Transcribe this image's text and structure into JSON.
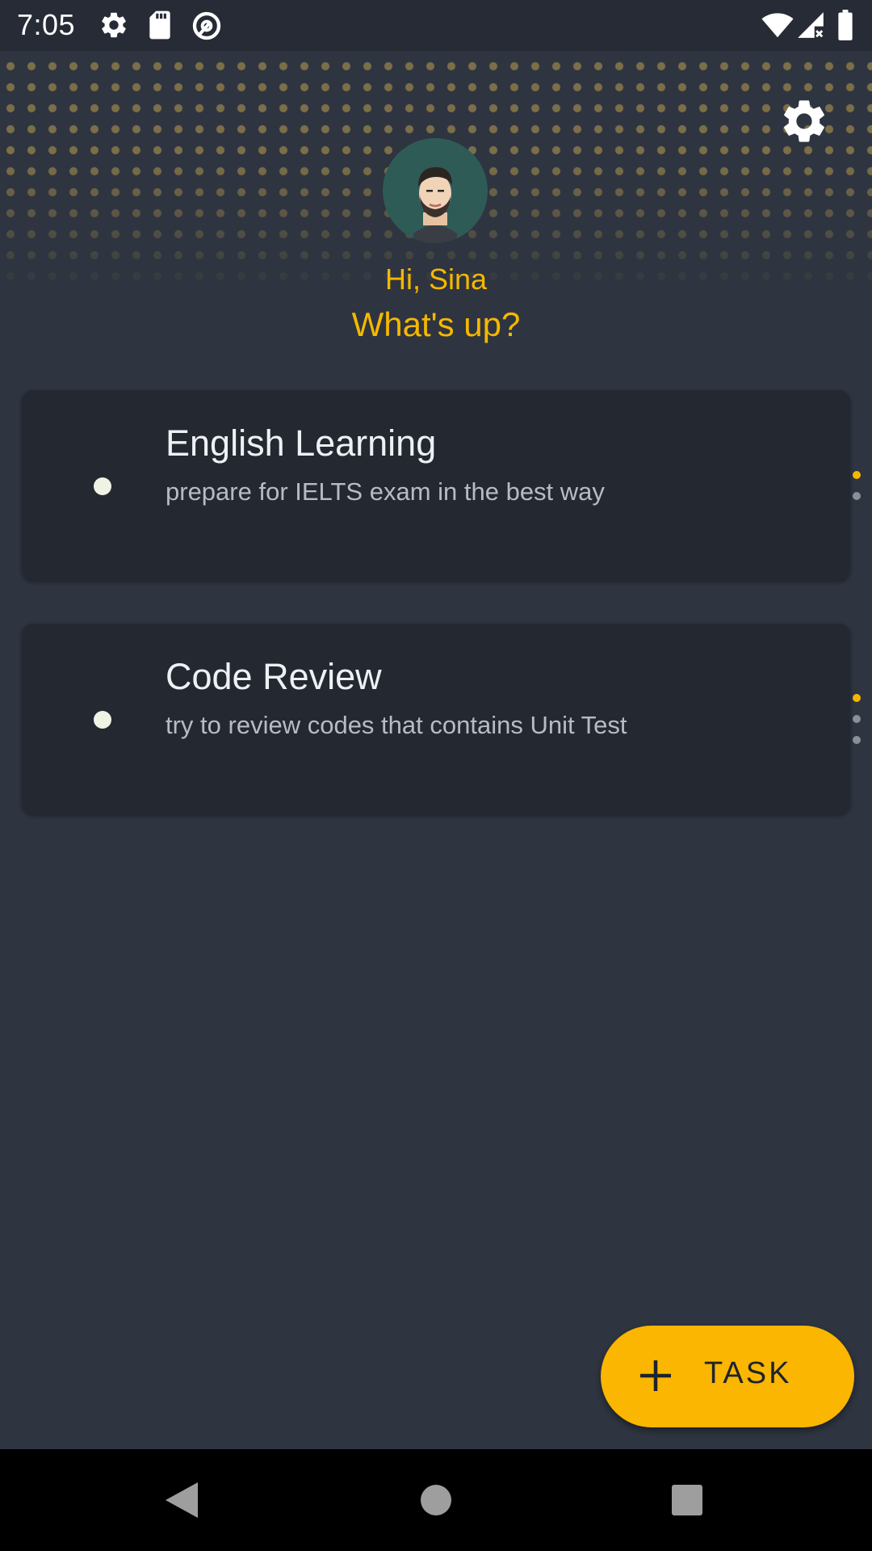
{
  "status_bar": {
    "time": "7:05",
    "left_icons": [
      "gear-icon",
      "sd-card-icon",
      "data-saver-icon"
    ],
    "right_icons": [
      "wifi-icon",
      "signal-no-data-icon",
      "battery-icon"
    ]
  },
  "header": {
    "settings_icon": "gear-icon",
    "avatar": "avatar",
    "greeting": "Hi, Sina",
    "subgreeting": "What's up?"
  },
  "tasks": [
    {
      "title": "English Learning",
      "description": "prepare for IELTS exam in the best way",
      "dots": [
        "#f5b800",
        "#8a8f98"
      ]
    },
    {
      "title": "Code Review",
      "description": "try to review codes that contains Unit Test",
      "dots": [
        "#f5b800",
        "#8a8f98",
        "#8a8f98"
      ]
    }
  ],
  "fab": {
    "icon": "plus-icon",
    "label": "TASK"
  },
  "nav_bar": {
    "icons": [
      "back-icon",
      "home-icon",
      "recents-icon"
    ]
  },
  "colors": {
    "background": "#2e3440",
    "card": "#242831",
    "accent": "#f5b800",
    "fab": "#fab600"
  }
}
